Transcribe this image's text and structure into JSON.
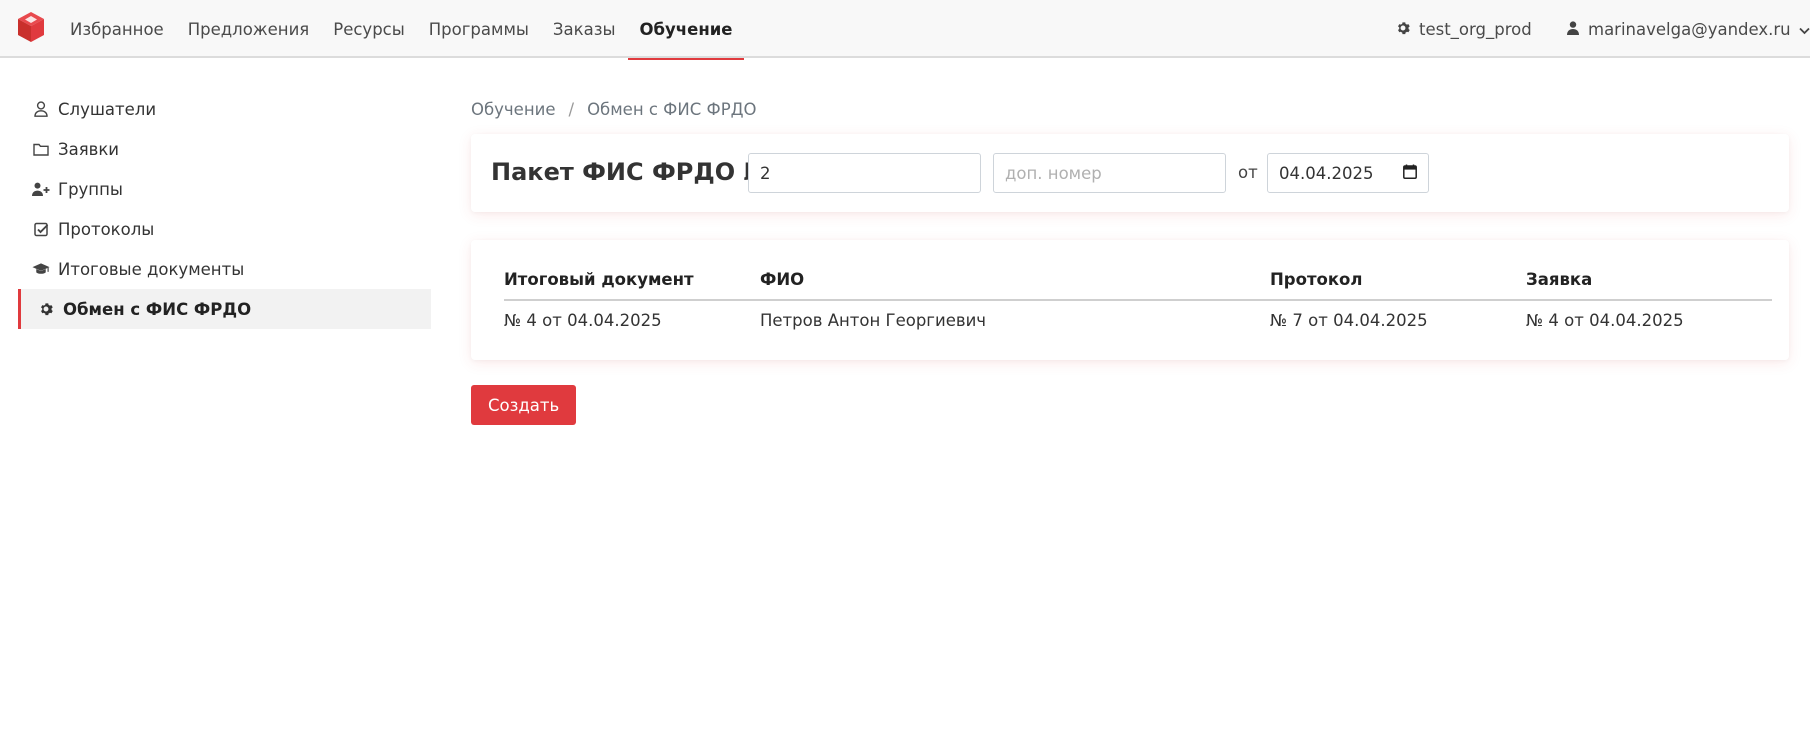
{
  "nav": {
    "items": [
      {
        "label": "Избранное"
      },
      {
        "label": "Предложения"
      },
      {
        "label": "Ресурсы"
      },
      {
        "label": "Программы"
      },
      {
        "label": "Заказы"
      },
      {
        "label": "Обучение",
        "active": true
      }
    ],
    "org": "test_org_prod",
    "user": "marinavelga@yandex.ru"
  },
  "sidebar": {
    "items": [
      {
        "label": "Слушатели",
        "icon": "user-outline-icon"
      },
      {
        "label": "Заявки",
        "icon": "folder-icon"
      },
      {
        "label": "Группы",
        "icon": "user-plus-icon"
      },
      {
        "label": "Протоколы",
        "icon": "check-square-icon"
      },
      {
        "label": "Итоговые документы",
        "icon": "graduation-cap-icon"
      },
      {
        "label": "Обмен с ФИС ФРДО",
        "icon": "gear-icon",
        "active": true
      }
    ]
  },
  "breadcrumb": {
    "parent": "Обучение",
    "separator": "/",
    "current": "Обмен с ФИС ФРДО"
  },
  "package": {
    "title": "Пакет ФИС ФРДО №",
    "number_value": "2",
    "extra_placeholder": "доп. номер",
    "from_label": "от",
    "date_value": "04.04.2025"
  },
  "table": {
    "headers": [
      "Итоговый документ",
      "ФИО",
      "Протокол",
      "Заявка"
    ],
    "rows": [
      [
        "№ 4 от 04.04.2025",
        "Петров Антон Георгиевич",
        "№ 7 от 04.04.2025",
        "№ 4 от 04.04.2025"
      ]
    ]
  },
  "actions": {
    "create_label": "Создать"
  },
  "colors": {
    "accent": "#e03a3e",
    "navbar_bg": "#f8f8f8"
  }
}
